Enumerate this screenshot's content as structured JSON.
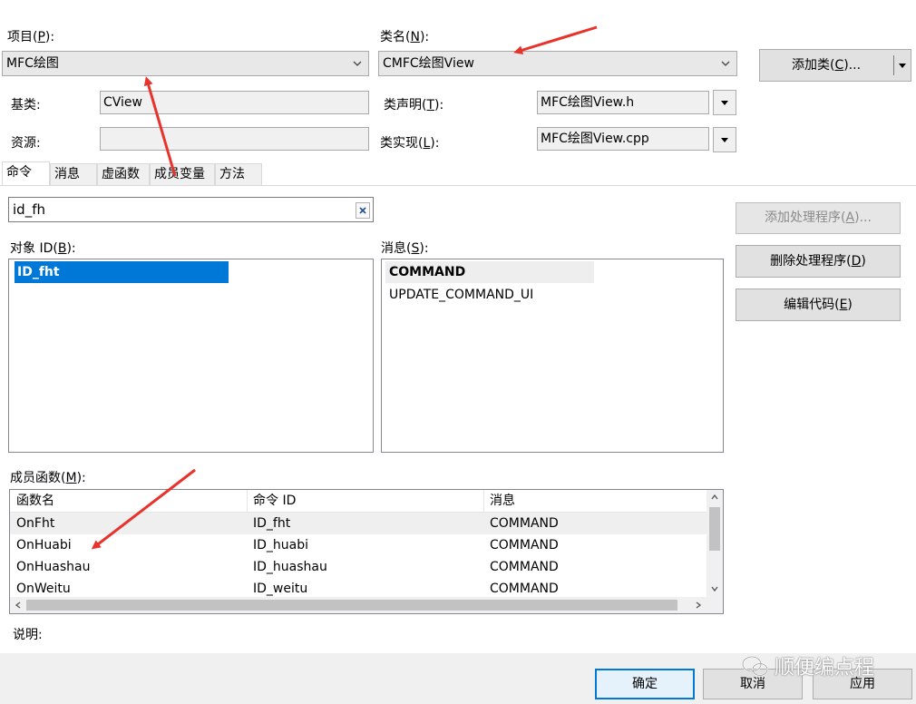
{
  "top": {
    "project_label": "项目(",
    "project_key": "P",
    "project_label_end": "):",
    "project_value": "MFC绘图",
    "classname_label": "类名(",
    "classname_key": "N",
    "classname_label_end": "):",
    "classname_value": "CMFC绘图View",
    "add_class_label": "添加类(",
    "add_class_key": "C",
    "add_class_end": ")...",
    "base_label": "基类:",
    "base_value": "CView",
    "resource_label": "资源:",
    "resource_value": "",
    "decl_label": "类声明(",
    "decl_key": "T",
    "decl_end": "):",
    "decl_value": "MFC绘图View.h",
    "impl_label": "类实现(",
    "impl_key": "L",
    "impl_end": "):",
    "impl_value": "MFC绘图View.cpp"
  },
  "tabs": [
    "命令",
    "消息",
    "虚函数",
    "成员变量",
    "方法"
  ],
  "search": {
    "value": "id_fh"
  },
  "objects": {
    "label": "对象 ID(",
    "key": "B",
    "label_end": "):",
    "items": [
      "ID_fht"
    ]
  },
  "messages": {
    "label": "消息(",
    "key": "S",
    "label_end": "):",
    "items": [
      "COMMAND",
      "UPDATE_COMMAND_UI"
    ]
  },
  "actions": {
    "add_handler": "添加处理程序(",
    "add_handler_key": "A",
    "add_handler_end": ")...",
    "delete_handler": "删除处理程序(",
    "delete_handler_key": "D",
    "delete_handler_end": ")",
    "edit_code": "编辑代码(",
    "edit_code_key": "E",
    "edit_code_end": ")"
  },
  "members": {
    "label": "成员函数(",
    "key": "M",
    "label_end": "):",
    "columns": [
      "函数名",
      "命令 ID",
      "消息"
    ],
    "rows": [
      [
        "OnFht",
        "ID_fht",
        "COMMAND"
      ],
      [
        "OnHuabi",
        "ID_huabi",
        "COMMAND"
      ],
      [
        "OnHuashau",
        "ID_huashau",
        "COMMAND"
      ],
      [
        "OnWeitu",
        "ID_weitu",
        "COMMAND"
      ]
    ]
  },
  "description_label": "说明:",
  "footer": {
    "ok": "确定",
    "cancel": "取消",
    "apply": "应用",
    "watermark": "顺便编点程"
  },
  "colors": {
    "selection": "#0078d7",
    "arrow": "#e8322b"
  }
}
